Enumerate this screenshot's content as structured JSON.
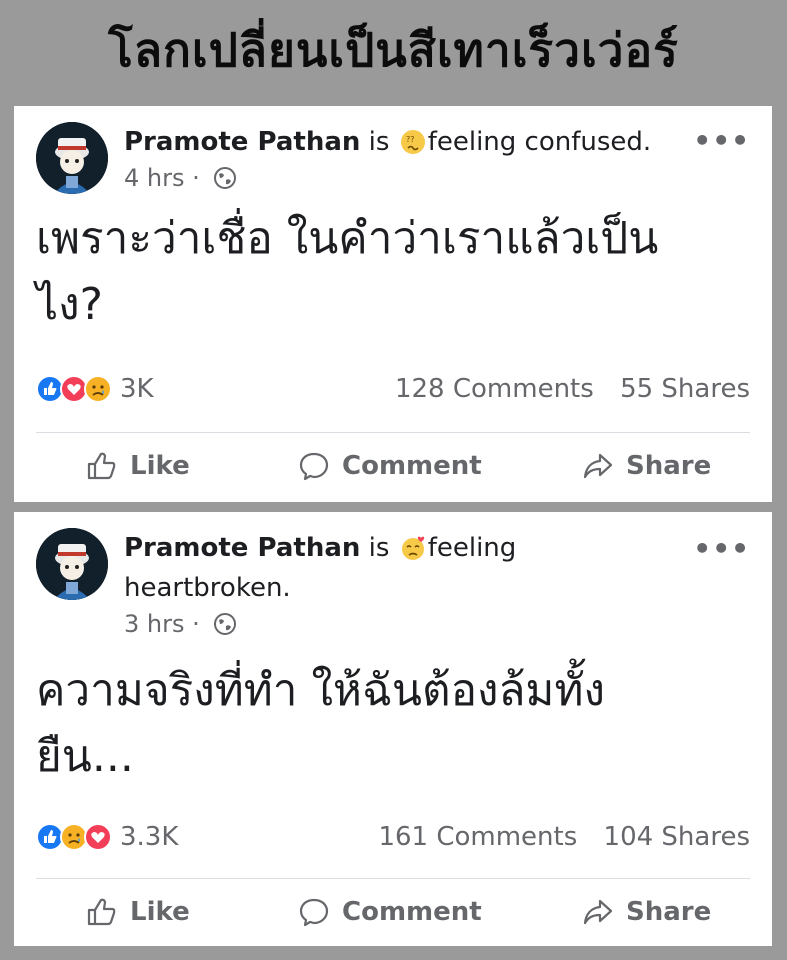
{
  "headline": "โลกเปลี่ยนเป็นสีเทาเร็วเว่อร์",
  "posts": [
    {
      "author": "Pramote Pathan",
      "is_text": "is",
      "feeling": "feeling confused.",
      "feeling_icon": "confused-face-icon",
      "time": "4 hrs",
      "dot": "·",
      "body_lines": [
        "เพราะว่าเชื่อ ในคำว่าเราแล้วเป็น",
        "ไง?"
      ],
      "reactions": [
        "like",
        "love",
        "sad"
      ],
      "reaction_count": "3K",
      "comments": "128 Comments",
      "shares": "55 Shares",
      "more": "•••"
    },
    {
      "author": "Pramote Pathan",
      "is_text": "is",
      "feeling": "feeling",
      "feeling_line2": "heartbroken.",
      "feeling_icon": "heartbroken-face-icon",
      "time": "3 hrs",
      "dot": "·",
      "body_lines": [
        "ความจริงที่ทำ ให้ฉันต้องล้มทั้ง",
        "ยืน..."
      ],
      "reactions": [
        "like",
        "sad",
        "love"
      ],
      "reaction_count": "3.3K",
      "comments": "161 Comments",
      "shares": "104 Shares",
      "more": "•••"
    }
  ],
  "actions": {
    "like": "Like",
    "comment": "Comment",
    "share": "Share"
  },
  "colors": {
    "like_blue": "#1877f2",
    "love_red": "#f33e58",
    "sad_yellow": "#f7b125",
    "text_gray": "#65676b"
  }
}
